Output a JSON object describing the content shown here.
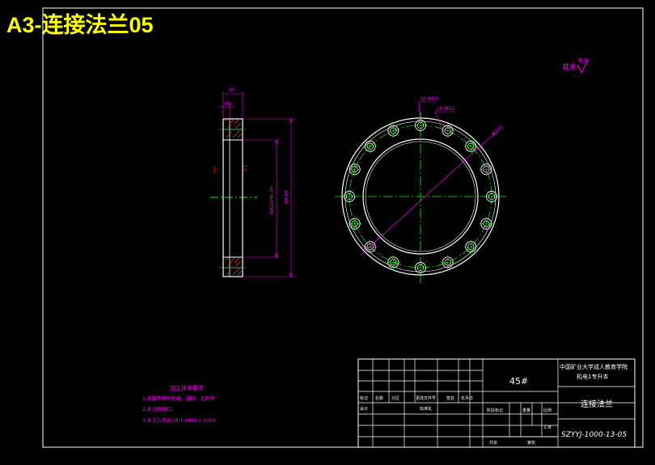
{
  "sheet_title": "A3-连接法兰05",
  "roughness_label": "其余:",
  "roughness_value": "6.3",
  "side_view": {
    "dim_width_top": "90",
    "dim_width_inner": "40",
    "dim_left_label": "M0",
    "dim_mid_label": "R3",
    "dim_bore": "Φ620H6-7H",
    "dim_outer": "Φ630"
  },
  "front_view": {
    "dim_holes_a": "16-Φ30",
    "dim_holes_b": "16-Φ52",
    "dim_pcd": "Φ745"
  },
  "tech_requirements": {
    "title": "加工技术要求",
    "lines": [
      "1.表面不得有划痕、磕碰、毛刺等",
      "2.未注倒角C1",
      "3.未注公差按GB/T 1800.1-2009"
    ]
  },
  "title_block": {
    "material": "45#",
    "institution_line1": "中国矿业大学成人教育学院",
    "institution_line2": "机电1专升本",
    "part_name": "连接法兰",
    "drawing_number": "SZYYJ-1000-13-05",
    "scale": "1:8",
    "revision_headers": [
      "标记",
      "处数",
      "分区",
      "更改文件号",
      "签名",
      "年月日"
    ],
    "designer_label": "设计",
    "standardize_label": "标准化",
    "stage_mark_label": "阶段标记",
    "weight_label": "重量",
    "ratio_label": "比例",
    "sheet_total_label": "共张",
    "sheet_no_label": "第张"
  }
}
